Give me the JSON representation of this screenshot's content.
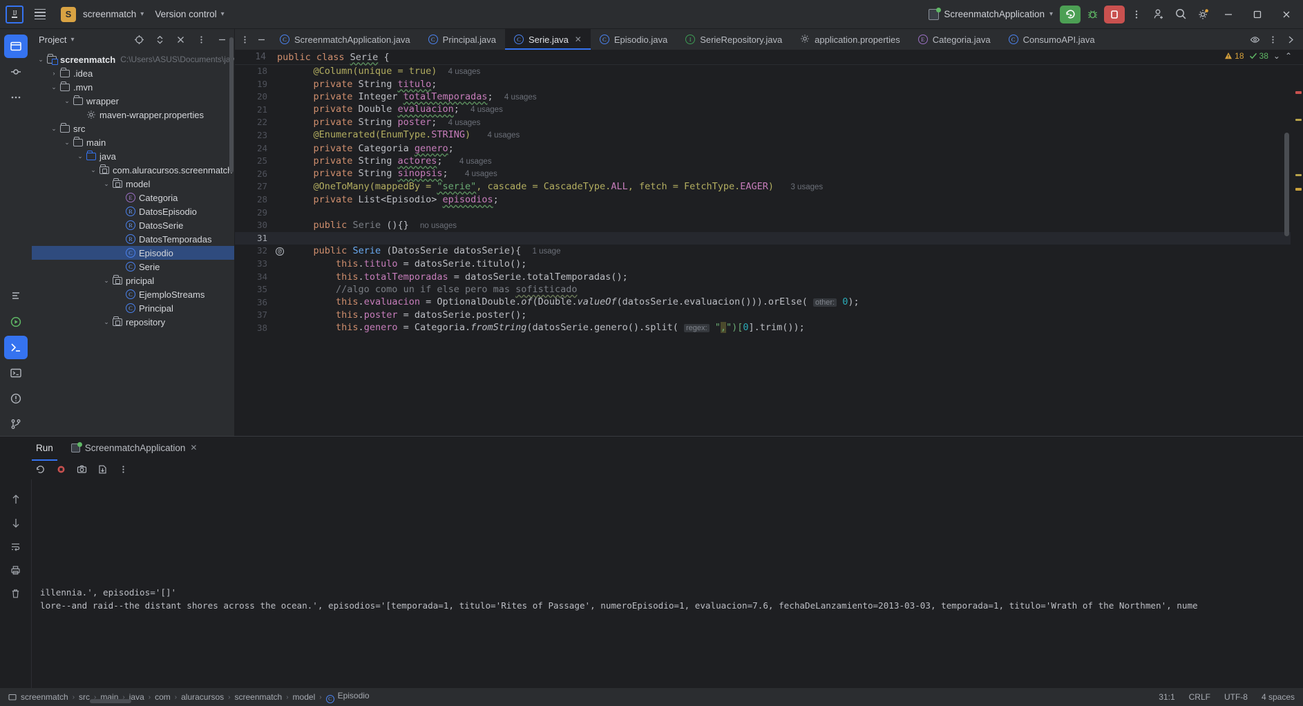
{
  "titlebar": {
    "logo": "intellij-logo",
    "project_badge": "S",
    "project_name": "screenmatch",
    "version_control": "Version control",
    "run_config": "ScreenmatchApplication",
    "buttons": {
      "run": "run-button",
      "debug": "debug-button",
      "stop": "stop-button",
      "more": "more-actions-button",
      "account": "account-button",
      "search": "search-button",
      "settings": "settings-button",
      "minimize": "minimize-button",
      "maximize": "maximize-button",
      "close": "close-button"
    }
  },
  "project_panel": {
    "title": "Project",
    "tree": [
      {
        "indent": 0,
        "arrow": "down",
        "icon": "module",
        "label": "screenmatch",
        "bold": true,
        "sub": "C:\\Users\\ASUS\\Documents\\java-pr",
        "selected": false
      },
      {
        "indent": 1,
        "arrow": "right",
        "icon": "folder",
        "label": ".idea",
        "bold": false,
        "sub": "",
        "selected": false
      },
      {
        "indent": 1,
        "arrow": "down",
        "icon": "folder",
        "label": ".mvn",
        "bold": false,
        "sub": "",
        "selected": false
      },
      {
        "indent": 2,
        "arrow": "down",
        "icon": "folder",
        "label": "wrapper",
        "bold": false,
        "sub": "",
        "selected": false
      },
      {
        "indent": 3,
        "arrow": "none",
        "icon": "properties",
        "label": "maven-wrapper.properties",
        "bold": false,
        "sub": "",
        "selected": false
      },
      {
        "indent": 1,
        "arrow": "down",
        "icon": "folder",
        "label": "src",
        "bold": false,
        "sub": "",
        "selected": false
      },
      {
        "indent": 2,
        "arrow": "down",
        "icon": "folder",
        "label": "main",
        "bold": false,
        "sub": "",
        "selected": false
      },
      {
        "indent": 3,
        "arrow": "down",
        "icon": "folder-blue",
        "label": "java",
        "bold": false,
        "sub": "",
        "selected": false
      },
      {
        "indent": 4,
        "arrow": "down",
        "icon": "package",
        "label": "com.aluracursos.screenmatch",
        "bold": false,
        "sub": "",
        "selected": false
      },
      {
        "indent": 5,
        "arrow": "down",
        "icon": "package",
        "label": "model",
        "bold": false,
        "sub": "",
        "selected": false
      },
      {
        "indent": 6,
        "arrow": "none",
        "icon": "enum",
        "label": "Categoria",
        "bold": false,
        "sub": "",
        "selected": false
      },
      {
        "indent": 6,
        "arrow": "none",
        "icon": "record",
        "label": "DatosEpisodio",
        "bold": false,
        "sub": "",
        "selected": false
      },
      {
        "indent": 6,
        "arrow": "none",
        "icon": "record",
        "label": "DatosSerie",
        "bold": false,
        "sub": "",
        "selected": false
      },
      {
        "indent": 6,
        "arrow": "none",
        "icon": "record",
        "label": "DatosTemporadas",
        "bold": false,
        "sub": "",
        "selected": false
      },
      {
        "indent": 6,
        "arrow": "none",
        "icon": "class",
        "label": "Episodio",
        "bold": false,
        "sub": "",
        "selected": true
      },
      {
        "indent": 6,
        "arrow": "none",
        "icon": "class",
        "label": "Serie",
        "bold": false,
        "sub": "",
        "selected": false
      },
      {
        "indent": 5,
        "arrow": "down",
        "icon": "package",
        "label": "pricipal",
        "bold": false,
        "sub": "",
        "selected": false
      },
      {
        "indent": 6,
        "arrow": "none",
        "icon": "class",
        "label": "EjemploStreams",
        "bold": false,
        "sub": "",
        "selected": false
      },
      {
        "indent": 6,
        "arrow": "none",
        "icon": "class",
        "label": "Principal",
        "bold": false,
        "sub": "",
        "selected": false
      },
      {
        "indent": 5,
        "arrow": "down",
        "icon": "package",
        "label": "repository",
        "bold": false,
        "sub": "",
        "selected": false
      }
    ]
  },
  "editor_tabs": [
    {
      "label": "ScreenmatchApplication.java",
      "icon": "class",
      "active": false,
      "closable": false
    },
    {
      "label": "Principal.java",
      "icon": "class",
      "active": false,
      "closable": false
    },
    {
      "label": "Serie.java",
      "icon": "class",
      "active": true,
      "closable": true
    },
    {
      "label": "Episodio.java",
      "icon": "class",
      "active": false,
      "closable": false
    },
    {
      "label": "SerieRepository.java",
      "icon": "interface",
      "active": false,
      "closable": false
    },
    {
      "label": "application.properties",
      "icon": "properties",
      "active": false,
      "closable": false
    },
    {
      "label": "Categoria.java",
      "icon": "enum",
      "active": false,
      "closable": false
    },
    {
      "label": "ConsumoAPI.java",
      "icon": "class",
      "active": false,
      "closable": false
    }
  ],
  "inspections": {
    "warnings": "18",
    "checks": "38"
  },
  "sticky_header": {
    "line": "14",
    "text": "public class Serie {"
  },
  "code_lines": [
    {
      "n": "18",
      "mark": "",
      "cur": false,
      "tokens": [
        {
          "t": "    ",
          "c": "plain"
        },
        {
          "t": "@Column",
          "c": "ann"
        },
        {
          "t": "(unique = ",
          "c": "ann"
        },
        {
          "t": "true",
          "c": "ann"
        },
        {
          "t": ")",
          "c": "ann"
        },
        {
          "t": "  ",
          "c": "plain"
        },
        {
          "t": "4 usages",
          "c": "usg"
        }
      ]
    },
    {
      "n": "19",
      "mark": "",
      "cur": false,
      "tokens": [
        {
          "t": "    ",
          "c": "plain"
        },
        {
          "t": "private",
          "c": "kw"
        },
        {
          "t": " String ",
          "c": "typ"
        },
        {
          "t": "titulo",
          "c": "fld wavy"
        },
        {
          "t": ";",
          "c": "typ"
        }
      ]
    },
    {
      "n": "20",
      "mark": "",
      "cur": false,
      "tokens": [
        {
          "t": "    ",
          "c": "plain"
        },
        {
          "t": "private",
          "c": "kw"
        },
        {
          "t": " Integer ",
          "c": "typ"
        },
        {
          "t": "totalTemporadas",
          "c": "fld wavy"
        },
        {
          "t": ";",
          "c": "typ"
        },
        {
          "t": "  ",
          "c": "plain"
        },
        {
          "t": "4 usages",
          "c": "usg"
        }
      ]
    },
    {
      "n": "21",
      "mark": "",
      "cur": false,
      "tokens": [
        {
          "t": "    ",
          "c": "plain"
        },
        {
          "t": "private",
          "c": "kw"
        },
        {
          "t": " Double ",
          "c": "typ"
        },
        {
          "t": "evaluacion",
          "c": "fld wavy"
        },
        {
          "t": ";",
          "c": "typ"
        },
        {
          "t": "  ",
          "c": "plain"
        },
        {
          "t": "4 usages",
          "c": "usg"
        }
      ]
    },
    {
      "n": "22",
      "mark": "",
      "cur": false,
      "tokens": [
        {
          "t": "    ",
          "c": "plain"
        },
        {
          "t": "private",
          "c": "kw"
        },
        {
          "t": " String ",
          "c": "typ"
        },
        {
          "t": "poster",
          "c": "fld"
        },
        {
          "t": ";",
          "c": "typ"
        },
        {
          "t": "  ",
          "c": "plain"
        },
        {
          "t": "4 usages",
          "c": "usg"
        }
      ]
    },
    {
      "n": "23",
      "mark": "",
      "cur": false,
      "tokens": [
        {
          "t": "    ",
          "c": "plain"
        },
        {
          "t": "@Enumerated",
          "c": "ann"
        },
        {
          "t": "(EnumType.",
          "c": "ann"
        },
        {
          "t": "STRING",
          "c": "fld"
        },
        {
          "t": ")",
          "c": "ann"
        },
        {
          "t": "   ",
          "c": "plain"
        },
        {
          "t": "4 usages",
          "c": "usg"
        }
      ]
    },
    {
      "n": "24",
      "mark": "",
      "cur": false,
      "tokens": [
        {
          "t": "    ",
          "c": "plain"
        },
        {
          "t": "private",
          "c": "kw"
        },
        {
          "t": " Categoria ",
          "c": "typ"
        },
        {
          "t": "genero",
          "c": "fld wavy"
        },
        {
          "t": ";",
          "c": "typ"
        }
      ]
    },
    {
      "n": "25",
      "mark": "",
      "cur": false,
      "tokens": [
        {
          "t": "    ",
          "c": "plain"
        },
        {
          "t": "private",
          "c": "kw"
        },
        {
          "t": " String ",
          "c": "typ"
        },
        {
          "t": "actores",
          "c": "fld wavy"
        },
        {
          "t": ";",
          "c": "typ"
        },
        {
          "t": "   ",
          "c": "plain"
        },
        {
          "t": "4 usages",
          "c": "usg"
        }
      ]
    },
    {
      "n": "26",
      "mark": "",
      "cur": false,
      "tokens": [
        {
          "t": "    ",
          "c": "plain"
        },
        {
          "t": "private",
          "c": "kw"
        },
        {
          "t": " String ",
          "c": "typ"
        },
        {
          "t": "sinopsis",
          "c": "fld wavy"
        },
        {
          "t": ";",
          "c": "typ"
        },
        {
          "t": "   ",
          "c": "plain"
        },
        {
          "t": "4 usages",
          "c": "usg"
        }
      ]
    },
    {
      "n": "27",
      "mark": "",
      "cur": false,
      "tokens": [
        {
          "t": "    ",
          "c": "plain"
        },
        {
          "t": "@OneToMany",
          "c": "ann"
        },
        {
          "t": "(mappedBy = ",
          "c": "ann"
        },
        {
          "t": "\"serie\"",
          "c": "str wavy"
        },
        {
          "t": ", cascade = CascadeType.",
          "c": "ann"
        },
        {
          "t": "ALL",
          "c": "fld"
        },
        {
          "t": ", fetch = FetchType.",
          "c": "ann"
        },
        {
          "t": "EAGER",
          "c": "fld"
        },
        {
          "t": ")",
          "c": "ann"
        },
        {
          "t": "   ",
          "c": "plain"
        },
        {
          "t": "3 usages",
          "c": "usg"
        }
      ]
    },
    {
      "n": "28",
      "mark": "",
      "cur": false,
      "tokens": [
        {
          "t": "    ",
          "c": "plain"
        },
        {
          "t": "private",
          "c": "kw"
        },
        {
          "t": " List<Episodio> ",
          "c": "typ"
        },
        {
          "t": "episodios",
          "c": "fld wavy"
        },
        {
          "t": ";",
          "c": "typ"
        }
      ]
    },
    {
      "n": "29",
      "mark": "",
      "cur": false,
      "tokens": [
        {
          "t": "",
          "c": "plain"
        }
      ]
    },
    {
      "n": "30",
      "mark": "",
      "cur": false,
      "tokens": [
        {
          "t": "    ",
          "c": "plain"
        },
        {
          "t": "public",
          "c": "kw"
        },
        {
          "t": " ",
          "c": "plain"
        },
        {
          "t": "Serie",
          "c": "cmt"
        },
        {
          "t": " (){}",
          "c": "typ"
        },
        {
          "t": "  ",
          "c": "plain"
        },
        {
          "t": "no usages",
          "c": "usg"
        }
      ]
    },
    {
      "n": "31",
      "mark": "",
      "cur": true,
      "tokens": [
        {
          "t": "",
          "c": "plain"
        }
      ]
    },
    {
      "n": "32",
      "mark": "@",
      "cur": false,
      "tokens": [
        {
          "t": "    ",
          "c": "plain"
        },
        {
          "t": "public",
          "c": "kw"
        },
        {
          "t": " ",
          "c": "plain"
        },
        {
          "t": "Serie",
          "c": "cls"
        },
        {
          "t": " (DatosSerie datosSerie){",
          "c": "typ"
        },
        {
          "t": "  ",
          "c": "plain"
        },
        {
          "t": "1 usage",
          "c": "usg"
        }
      ]
    },
    {
      "n": "33",
      "mark": "",
      "cur": false,
      "tokens": [
        {
          "t": "        ",
          "c": "plain"
        },
        {
          "t": "this",
          "c": "kw"
        },
        {
          "t": ".",
          "c": "typ"
        },
        {
          "t": "titulo",
          "c": "fld"
        },
        {
          "t": " = datosSerie.titulo();",
          "c": "typ"
        }
      ]
    },
    {
      "n": "34",
      "mark": "",
      "cur": false,
      "tokens": [
        {
          "t": "        ",
          "c": "plain"
        },
        {
          "t": "this",
          "c": "kw"
        },
        {
          "t": ".",
          "c": "typ"
        },
        {
          "t": "totalTemporadas",
          "c": "fld"
        },
        {
          "t": " = datosSerie.totalTemporadas();",
          "c": "typ"
        }
      ]
    },
    {
      "n": "35",
      "mark": "",
      "cur": false,
      "tokens": [
        {
          "t": "        ",
          "c": "plain"
        },
        {
          "t": "//algo como un if else pero mas ",
          "c": "cmt"
        },
        {
          "t": "sofisticado",
          "c": "cmt wavyg"
        }
      ]
    },
    {
      "n": "36",
      "mark": "",
      "cur": false,
      "tokens": [
        {
          "t": "        ",
          "c": "plain"
        },
        {
          "t": "this",
          "c": "kw"
        },
        {
          "t": ".",
          "c": "typ"
        },
        {
          "t": "evaluacion",
          "c": "fld"
        },
        {
          "t": " = OptionalDouble.",
          "c": "typ"
        },
        {
          "t": "of",
          "c": "mth"
        },
        {
          "t": "(Double.",
          "c": "typ"
        },
        {
          "t": "valueOf",
          "c": "mth"
        },
        {
          "t": "(datosSerie.evaluacion())).orElse( ",
          "c": "typ"
        },
        {
          "t": "other:",
          "c": "hint"
        },
        {
          "t": " ",
          "c": "plain"
        },
        {
          "t": "0",
          "c": "num"
        },
        {
          "t": ");",
          "c": "typ"
        }
      ]
    },
    {
      "n": "37",
      "mark": "",
      "cur": false,
      "tokens": [
        {
          "t": "        ",
          "c": "plain"
        },
        {
          "t": "this",
          "c": "kw"
        },
        {
          "t": ".",
          "c": "typ"
        },
        {
          "t": "poster",
          "c": "fld"
        },
        {
          "t": " = datosSerie.poster();",
          "c": "typ"
        }
      ]
    },
    {
      "n": "38",
      "mark": "",
      "cur": false,
      "tokens": [
        {
          "t": "        ",
          "c": "plain"
        },
        {
          "t": "this",
          "c": "kw"
        },
        {
          "t": ".",
          "c": "typ"
        },
        {
          "t": "genero",
          "c": "fld"
        },
        {
          "t": " = Categoria.",
          "c": "typ"
        },
        {
          "t": "fromString",
          "c": "mth"
        },
        {
          "t": "(datosSerie.genero().split( ",
          "c": "typ"
        },
        {
          "t": "regex:",
          "c": "hint"
        },
        {
          "t": " ",
          "c": "plain"
        },
        {
          "t": "\"",
          "c": "str"
        },
        {
          "t": ",",
          "c": "str regexhl"
        },
        {
          "t": "\")[",
          "c": "str"
        },
        {
          "t": "0",
          "c": "num"
        },
        {
          "t": "].trim());",
          "c": "typ"
        }
      ]
    }
  ],
  "run_panel": {
    "tabs": [
      {
        "label": "Run",
        "icon": "",
        "active": true
      },
      {
        "label": "ScreenmatchApplication",
        "icon": "run-config-icon",
        "active": false,
        "closable": true
      }
    ],
    "toolbar": [
      "rerun-icon",
      "stop-icon",
      "screenshot-icon",
      "export-icon",
      "more-icon"
    ],
    "side_icons": [
      "scroll-up-icon",
      "scroll-down-icon",
      "soft-wrap-icon",
      "print-icon",
      "clear-all-icon"
    ],
    "console_lines": [
      "illennia.', episodios='[]'",
      "lore--and raid--the distant shores across the ocean.', episodios='[temporada=1, titulo='Rites of Passage', numeroEpisodio=1, evaluacion=7.6, fechaDeLanzamiento=2013-03-03, temporada=1, titulo='Wrath of the Northmen', nume"
    ]
  },
  "status_bar": {
    "breadcrumbs": [
      "screenmatch",
      "src",
      "main",
      "java",
      "com",
      "aluracursos",
      "screenmatch",
      "model",
      "Episodio"
    ],
    "caret": "31:1",
    "line_sep": "CRLF",
    "encoding": "UTF-8",
    "indent": "4 spaces"
  },
  "colors": {
    "accent": "#3573f0",
    "run_green": "#4c9f54",
    "stop_red": "#c9514f",
    "selection": "#2f4b7e",
    "badge": "#d9a343"
  }
}
